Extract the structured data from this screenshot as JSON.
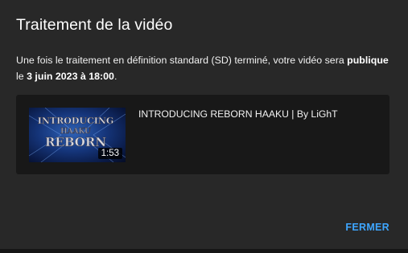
{
  "dialog": {
    "title": "Traitement de la vidéo",
    "message": {
      "part1": "Une fois le traitement en définition standard (SD) terminé, votre vidéo sera ",
      "visibility": "publique",
      "part2": " le ",
      "datetime": "3 juin 2023 à 18:00",
      "part3": "."
    },
    "video": {
      "title": "INTRODUCING REBORN HAAKU | By LiGhT",
      "duration": "1:53",
      "thumbnail_text": "INTRODUCING HAAKU REBORN"
    },
    "close_label": "FERMER"
  },
  "colors": {
    "dialog_bg": "#282828",
    "card_bg": "#181818",
    "accent": "#3ea6ff"
  }
}
